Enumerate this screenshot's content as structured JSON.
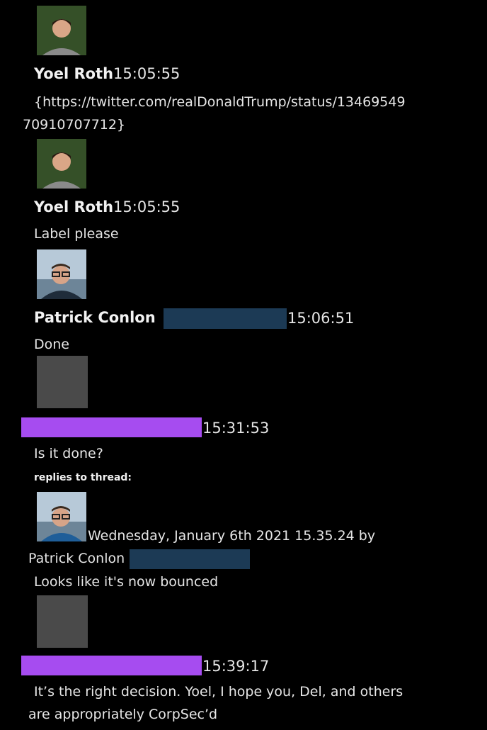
{
  "messages": {
    "m1": {
      "author": "Yoel Roth",
      "time": "15:05:55",
      "text_line1": "{https://twitter.com/realDonaldTrump/status/13469549",
      "text_line2": "70910707712}"
    },
    "m2": {
      "author": "Yoel Roth",
      "time": "15:05:55",
      "text": "Label please"
    },
    "m3": {
      "author": "Patrick Conlon",
      "time": "15:06:51",
      "text": "Done"
    },
    "m4": {
      "time": "15:31:53",
      "text": "Is it done?"
    },
    "thread": {
      "label": "replies to thread:",
      "meta": "Wednesday, January 6th 2021 15.35.24 by",
      "author": "Patrick Conlon",
      "text": "Looks like it's now bounced"
    },
    "m5": {
      "time": "15:39:17",
      "text_line1": "It’s the right decision. Yoel, I hope you, Del, and others",
      "text_line2": "are appropriately CorpSec’d"
    }
  },
  "colors": {
    "background": "#000000",
    "redaction_blue": "#1c3a55",
    "redaction_purple": "#a64cf0",
    "placeholder_gray": "#4a4a4a"
  }
}
